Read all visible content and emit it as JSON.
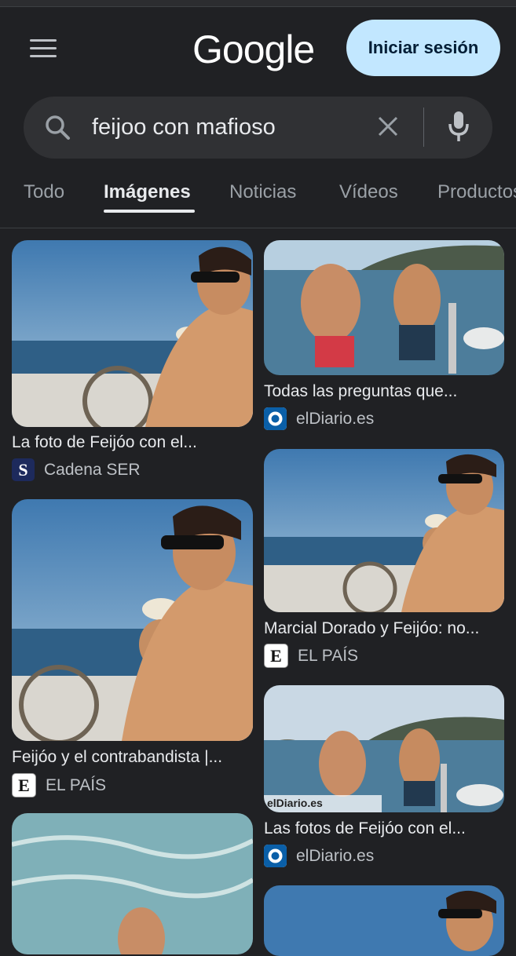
{
  "header": {
    "logo_text": "Google",
    "signin_label": "Iniciar sesión"
  },
  "search": {
    "query": "feijoo con mafioso"
  },
  "tabs": [
    {
      "label": "Todo",
      "active": false
    },
    {
      "label": "Imágenes",
      "active": true
    },
    {
      "label": "Noticias",
      "active": false
    },
    {
      "label": "Vídeos",
      "active": false
    },
    {
      "label": "Productos",
      "active": false
    }
  ],
  "results": [
    {
      "title": "La foto de Feijóo con el...",
      "source": "Cadena SER",
      "favicon": "ser-icon",
      "favicon_letter": "S"
    },
    {
      "title": "Todas las preguntas que...",
      "source": "elDiario.es",
      "favicon": "eldiario-icon"
    },
    {
      "title": "Marcial Dorado y Feijóo: no...",
      "source": "EL PAÍS",
      "favicon": "elpais-icon",
      "favicon_letter": "E"
    },
    {
      "title": "Feijóo y el contrabandista |...",
      "source": "EL PAÍS",
      "favicon": "elpais-icon",
      "favicon_letter": "E"
    },
    {
      "title": "Las fotos de Feijóo con el...",
      "source": "elDiario.es",
      "favicon": "eldiario-icon",
      "watermark": "elDiario.es"
    }
  ],
  "colors": {
    "background": "#202124",
    "signin_bg": "#c2e7ff",
    "searchbar_bg": "#303134"
  }
}
